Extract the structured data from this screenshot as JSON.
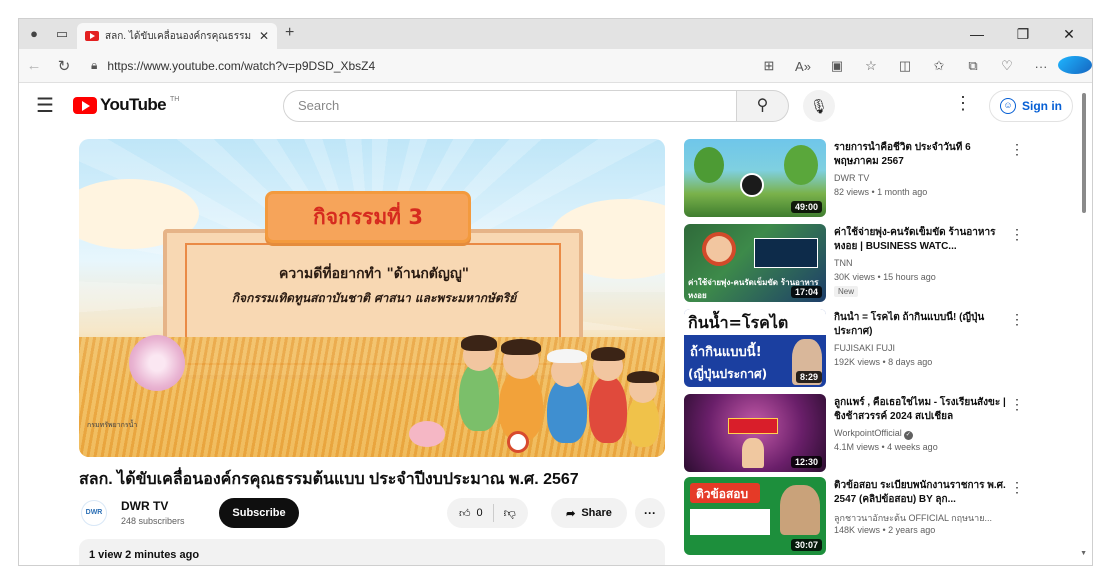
{
  "browser": {
    "tab_title": "สลก. ได้ขับเคลื่อนองค์กรคุณธรรม",
    "tab_close": "✕",
    "new_tab": "+",
    "url": "https://www.youtube.com/watch?v=p9DSD_XbsZ4",
    "window_controls": {
      "minimize": "—",
      "restore": "❐",
      "close": "✕"
    }
  },
  "youtube": {
    "logo_text": "YouTube",
    "logo_tm": "TH",
    "search_placeholder": "Search",
    "sign_in": "Sign in",
    "brand_color": "#ff0000",
    "link_color": "#065fd4"
  },
  "video": {
    "thumbnail": {
      "activity_title": "กิจกรรมที่ 3",
      "line1": "ความดีที่อยากทำ \"ด้านกตัญญู\"",
      "line2": "กิจกรรมเทิดทูนสถาบันชาติ ศาสนา และพระมหากษัตริย์",
      "watermark": "กรมทรัพยากรน้ำ"
    },
    "title": "สลก. ได้ขับเคลื่อนองค์กรคุณธรรมต้นแบบ ประจำปีงบประมาณ พ.ศ. 2567",
    "channel_avatar": "DWR",
    "channel_name": "DWR TV",
    "subscribers": "248 subscribers",
    "subscribe_label": "Subscribe",
    "like_count": "0",
    "share_label": "Share",
    "description_meta": "1 view  2 minutes ago"
  },
  "recommendations": [
    {
      "title": "รายการน้ำคือชีวิต ประจำวันที่ 6 พฤษภาคม 2567",
      "channel": "DWR TV",
      "meta": "82 views • 1 month ago",
      "duration": "49:00",
      "badge": "",
      "verified": false
    },
    {
      "title": "ค่าใช้จ่ายพุ่ง-คนรัดเข็มขัด ร้านอาหารหงอย | BUSINESS WATC...",
      "channel": "TNN",
      "meta": "30K views • 15 hours ago",
      "duration": "17:04",
      "badge": "New",
      "verified": false,
      "thumb_caption": "ค่าใช้จ่ายพุ่ง-คนรัดเข็มขัด ร้านอาหารหงอย"
    },
    {
      "title": "กินน้ำ = โรคไต ถ้ากินแบบนี้! (ญี่ปุ่นประกาศ)",
      "channel": "FUJISAKI FUJI",
      "meta": "192K views • 8 days ago",
      "duration": "8:29",
      "badge": "",
      "verified": false,
      "thumb_text_1": "กินน้ำ=โรคไต",
      "thumb_text_2": "ถ้ากินแบบนี้!",
      "thumb_text_3": "(ญี่ปุ่นประกาศ)"
    },
    {
      "title": "ลูกแพร์ , คือเธอใช่ไหม - โรงเรียนสังขะ | ชิงช้าสวรรค์ 2024 สเปเชียล",
      "channel": "WorkpointOfficial",
      "meta": "4.1M views • 4 weeks ago",
      "duration": "12:30",
      "badge": "",
      "verified": true
    },
    {
      "title": "ติวข้อสอบ ระเบียบพนักงานราชการ พ.ศ. 2547 (คลิปข้อสอบ) BY ลุก...",
      "channel": "ลูกชาวนาอักษะต้น OFFICIAL กฤษนาย...",
      "meta": "148K views • 2 years ago",
      "duration": "30:07",
      "badge": "",
      "verified": false,
      "thumb_text_1": "ติวข้อสอบ"
    }
  ]
}
